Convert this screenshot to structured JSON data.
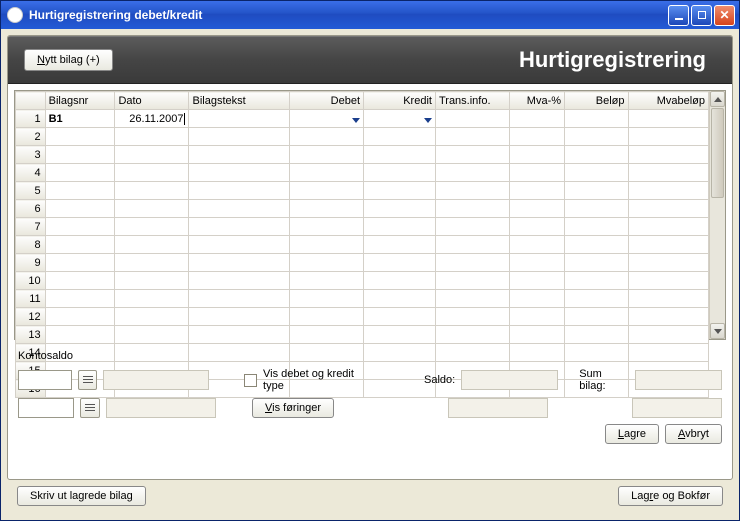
{
  "titlebar": {
    "text": "Hurtigregistrering debet/kredit"
  },
  "topband": {
    "new_button_u": "N",
    "new_button_rest": "ytt bilag (+)",
    "heading": "Hurtigregistrering"
  },
  "grid": {
    "headers": {
      "bilagsnr": "Bilagsnr",
      "dato": "Dato",
      "bilagstekst": "Bilagstekst",
      "debet": "Debet",
      "kredit": "Kredit",
      "trans": "Trans.info.",
      "mva": "Mva-%",
      "belop": "Beløp",
      "mvabelop": "Mvabeløp"
    },
    "row1": {
      "bilagsnr": "B1",
      "dato": "26.11.2007"
    },
    "rownums": [
      "1",
      "2",
      "3",
      "4",
      "5",
      "6",
      "7",
      "8",
      "9",
      "10",
      "11",
      "12",
      "13",
      "14",
      "15",
      "16"
    ]
  },
  "lower": {
    "kontosaldo": "Kontosaldo",
    "vis_type": "Vis debet og kredit type",
    "vis_foringer_u": "V",
    "vis_foringer_rest": "is føringer",
    "saldo": "Saldo:",
    "sumbilag": "Sum bilag:",
    "lagre_u": "L",
    "lagre_rest": "agre",
    "avbryt_u": "A",
    "avbryt_rest": "vbryt"
  },
  "bottom": {
    "skriv": "Skriv ut lagrede bilag",
    "lagre_bokfor_pre": "Lag",
    "lagre_bokfor_u": "r",
    "lagre_bokfor_rest": "e og Bokfør"
  }
}
